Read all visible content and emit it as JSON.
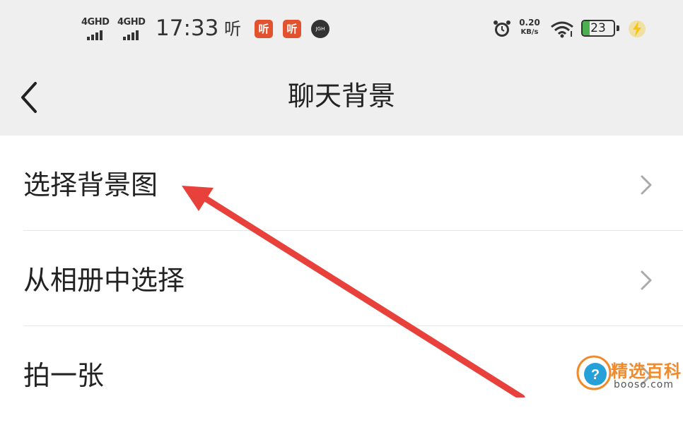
{
  "status_bar": {
    "signal_1": "4GHD",
    "signal_2": "4GHD",
    "time": "17:33",
    "app_icon_1": "听",
    "app_icon_2": "听",
    "app_icon_3": "听",
    "app_icon_4": "JGH",
    "net_speed_value": "0.20",
    "net_speed_unit": "KB/s",
    "battery_level": "23",
    "battery_fill_fraction": 0.23,
    "icons": [
      "signal-icon",
      "signal-icon",
      "listen-app-icon",
      "listen-app-icon",
      "app-dot-icon",
      "alarm-icon",
      "wifi-icon",
      "battery-icon",
      "charging-bolt-icon"
    ]
  },
  "navbar": {
    "back_icon": "chevron-left-icon",
    "title": "聊天背景"
  },
  "menu": {
    "items": [
      {
        "label": "选择背景图",
        "icon": "chevron-right-icon"
      },
      {
        "label": "从相册中选择",
        "icon": "chevron-right-icon"
      },
      {
        "label": "拍一张",
        "icon": "chevron-right-icon"
      }
    ]
  },
  "annotation": {
    "type": "red-arrow",
    "color": "#e8403a",
    "points_to": "选择背景图"
  },
  "watermark": {
    "brand": "精选百科",
    "url": "booso.com",
    "logo_icon": "question-mark-icon"
  },
  "colors": {
    "bar_background": "#efefef",
    "battery_green": "#4caf50",
    "bolt_yellow": "#f5c518",
    "app_icon_red": "#e2522e"
  }
}
